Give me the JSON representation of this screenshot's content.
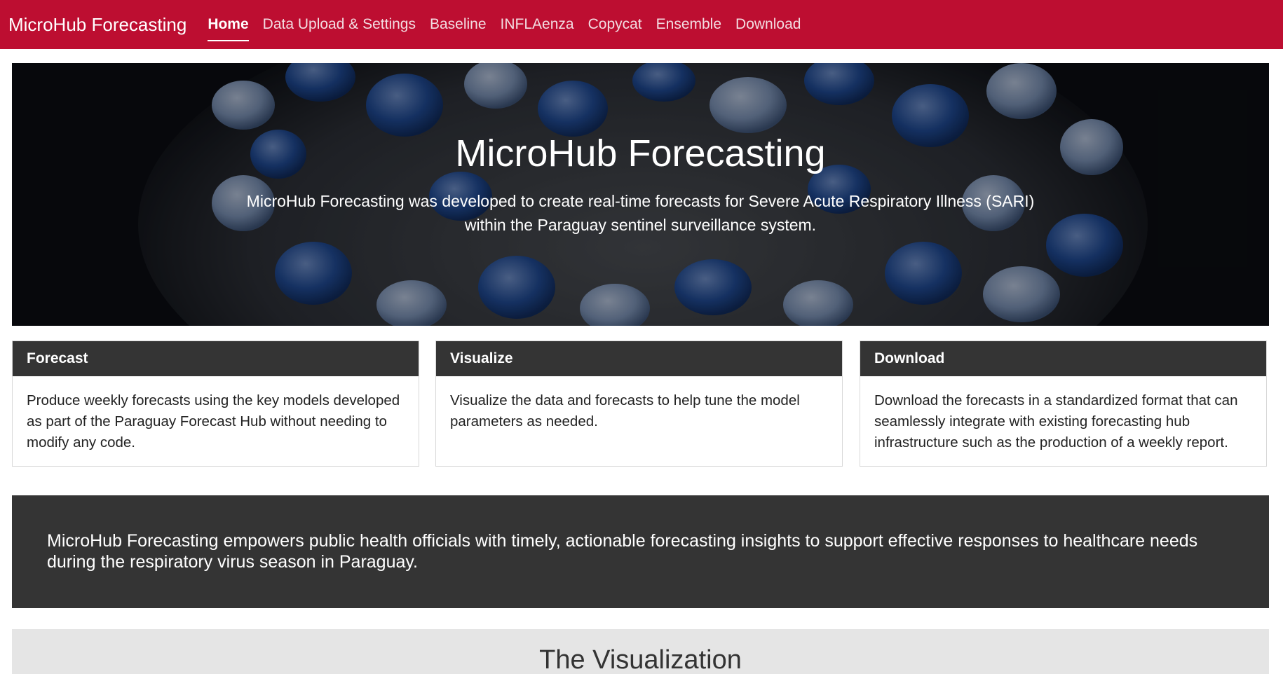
{
  "navbar": {
    "brand": "MicroHub Forecasting",
    "items": [
      {
        "label": "Home",
        "active": true
      },
      {
        "label": "Data Upload & Settings",
        "active": false
      },
      {
        "label": "Baseline",
        "active": false
      },
      {
        "label": "INFLAenza",
        "active": false
      },
      {
        "label": "Copycat",
        "active": false
      },
      {
        "label": "Ensemble",
        "active": false
      },
      {
        "label": "Download",
        "active": false
      }
    ],
    "color": "#bd0e31"
  },
  "hero": {
    "title": "MicroHub Forecasting",
    "description": "MicroHub Forecasting was developed to create real-time forecasts for Severe Acute Respiratory Illness (SARI) within the Paraguay sentinel surveillance system."
  },
  "cards": [
    {
      "title": "Forecast",
      "body": "Produce weekly forecasts using the key models developed as part of the Paraguay Forecast Hub without needing to modify any code."
    },
    {
      "title": "Visualize",
      "body": "Visualize the data and forecasts to help tune the model parameters as needed."
    },
    {
      "title": "Download",
      "body": "Download the forecasts in a standardized format that can seamlessly integrate with existing forecasting hub infrastructure such as the production of a weekly report."
    }
  ],
  "banner": {
    "text": "MicroHub Forecasting empowers public health officials with timely, actionable forecasting insights to support effective responses to healthcare needs during the respiratory virus season in Paraguay."
  },
  "visualization": {
    "title": "The Visualization"
  }
}
